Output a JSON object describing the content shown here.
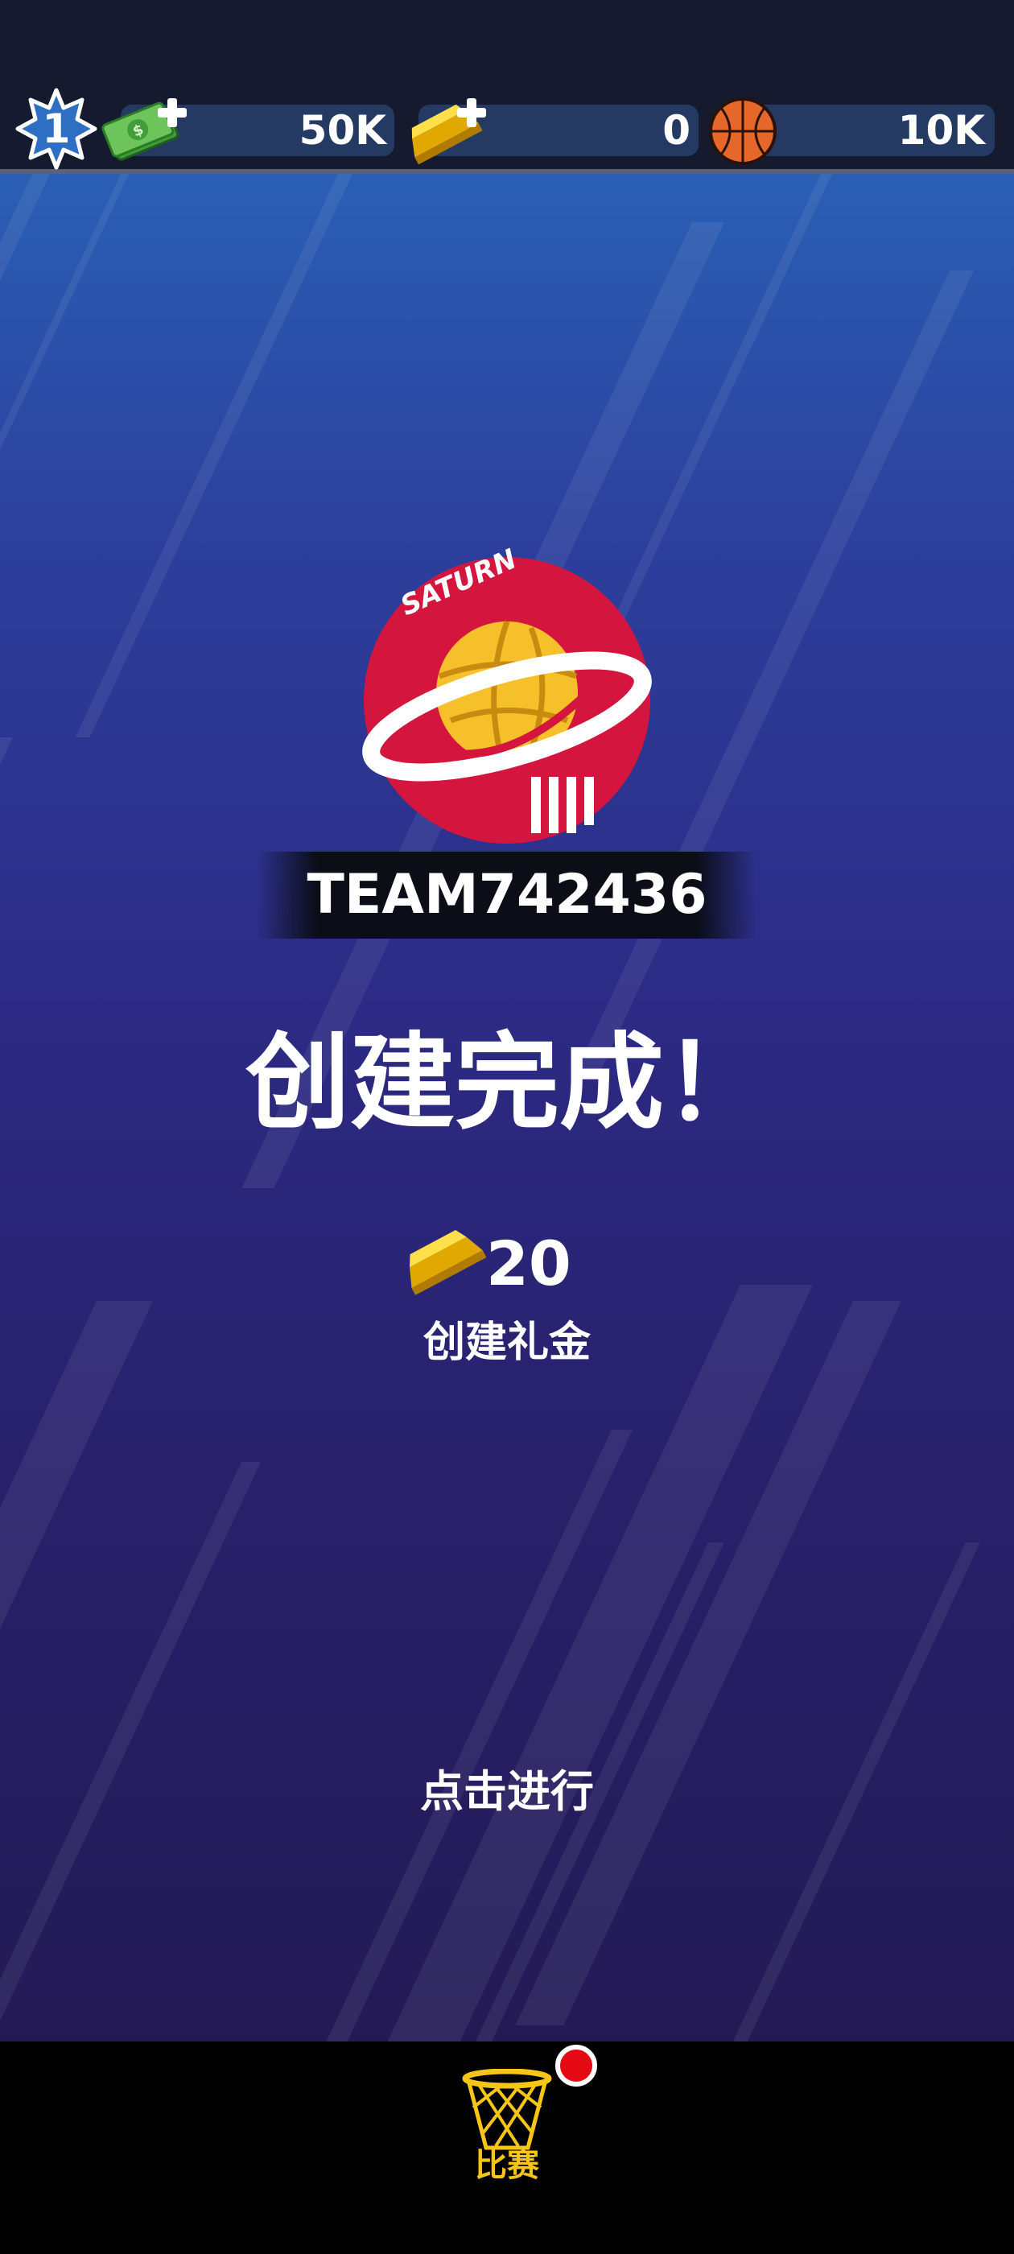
{
  "header": {
    "level": "1",
    "cash": {
      "value": "50K",
      "icon": "cash-icon"
    },
    "gold": {
      "value": "0",
      "icon": "gold-bar-icon"
    },
    "basketballs": {
      "value": "10K",
      "icon": "basketball-icon"
    }
  },
  "team": {
    "logo_text": "SATURN",
    "name": "TEAM742436"
  },
  "result": {
    "headline": "创建完成！",
    "reward_amount": "20",
    "reward_label": "创建礼金"
  },
  "prompt": "点击进行",
  "bottom_nav": {
    "items": [
      {
        "label": "比赛",
        "icon": "basketball-hoop-icon",
        "has_notification": true
      }
    ]
  },
  "colors": {
    "accent": "#f5c518",
    "logo_red": "#d4163f",
    "notification": "#e50914"
  }
}
